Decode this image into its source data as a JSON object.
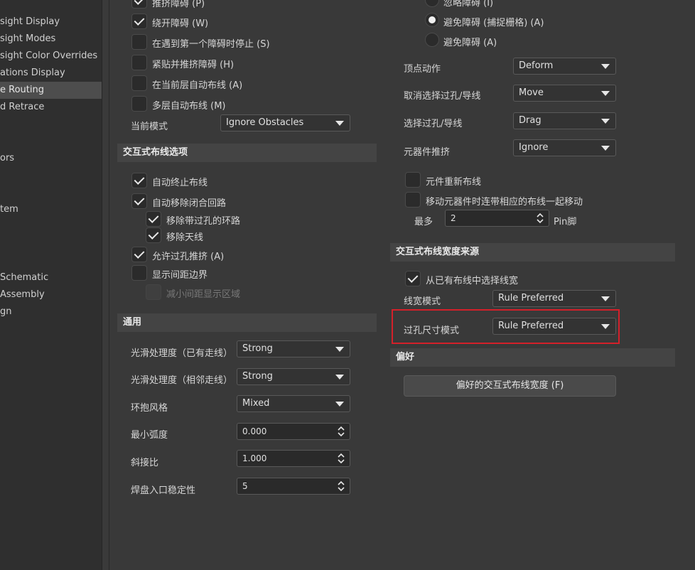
{
  "sidebar": {
    "items": [
      {
        "label": "sight Display"
      },
      {
        "label": "sight Modes"
      },
      {
        "label": "sight Color Overrides"
      },
      {
        "label": "ations Display"
      },
      {
        "label": "e Routing",
        "active": true
      },
      {
        "label": "d Retrace"
      },
      {
        "label": "ors"
      },
      {
        "label": "tem"
      },
      {
        "label": "Schematic"
      },
      {
        "label": "Assembly"
      },
      {
        "label": "gn"
      }
    ]
  },
  "left": {
    "top_options": [
      {
        "label": "推挤障碍 (P)",
        "checked": true
      },
      {
        "label": "绕开障碍 (W)",
        "checked": true
      },
      {
        "label": "在遇到第一个障碍时停止 (S)",
        "checked": false
      },
      {
        "label": "紧贴并推挤障碍 (H)",
        "checked": false
      },
      {
        "label": "在当前层自动布线 (A)",
        "checked": false
      },
      {
        "label": "多层自动布线 (M)",
        "checked": false
      }
    ],
    "current_mode_label": "当前模式",
    "current_mode_value": "Ignore Obstacles",
    "interactive_section_title": "交互式布线选项",
    "interactive_options": [
      {
        "label": "自动终止布线",
        "checked": true
      },
      {
        "label": "自动移除闭合回路",
        "checked": true
      },
      {
        "label": "移除带过孔的环路",
        "checked": true
      },
      {
        "label": "移除天线",
        "checked": true
      },
      {
        "label": "允许过孔推挤 (A)",
        "checked": true
      },
      {
        "label": "显示间距边界",
        "checked": false
      },
      {
        "label": "减小间距显示区域",
        "checked": false,
        "disabled": true
      }
    ],
    "general_section_title": "通用",
    "general": [
      {
        "label": "光滑处理度（已有走线）",
        "value": "Strong",
        "kind": "dropdown"
      },
      {
        "label": "光滑处理度（相邻走线）",
        "value": "Strong",
        "kind": "dropdown"
      },
      {
        "label": "环抱风格",
        "value": "Mixed",
        "kind": "dropdown"
      },
      {
        "label": "最小弧度",
        "value": "0.000",
        "kind": "spin"
      },
      {
        "label": "斜接比",
        "value": "1.000",
        "kind": "spin"
      },
      {
        "label": "焊盘入口稳定性",
        "value": "5",
        "kind": "spin"
      }
    ]
  },
  "right": {
    "radios": [
      {
        "label": "忽略障碍 (I)",
        "checked": false
      },
      {
        "label": "避免障碍 (捕捉栅格) (A)",
        "checked": true
      },
      {
        "label": "避免障碍 (A)",
        "checked": false
      }
    ],
    "actions": [
      {
        "label": "顶点动作",
        "value": "Deform"
      },
      {
        "label": "取消选择过孔/导线",
        "value": "Move"
      },
      {
        "label": "选择过孔/导线",
        "value": "Drag"
      },
      {
        "label": "元器件推挤",
        "value": "Ignore"
      }
    ],
    "reroute_label": "元件重新布线",
    "move_with_label": "移动元器件时连带相应的布线一起移动",
    "max_label": "最多",
    "max_value": "2",
    "max_unit": "Pin脚",
    "width_section_title": "交互式布线宽度来源",
    "pick_existing_label": "从已有布线中选择线宽",
    "width_mode_label": "线宽模式",
    "width_mode_value": "Rule Preferred",
    "via_mode_label": "过孔尺寸模式",
    "via_mode_value": "Rule Preferred",
    "favorites_section_title": "偏好",
    "favorites_button": "偏好的交互式布线宽度 (F)"
  },
  "colors": {
    "highlight": "#d4202a"
  }
}
